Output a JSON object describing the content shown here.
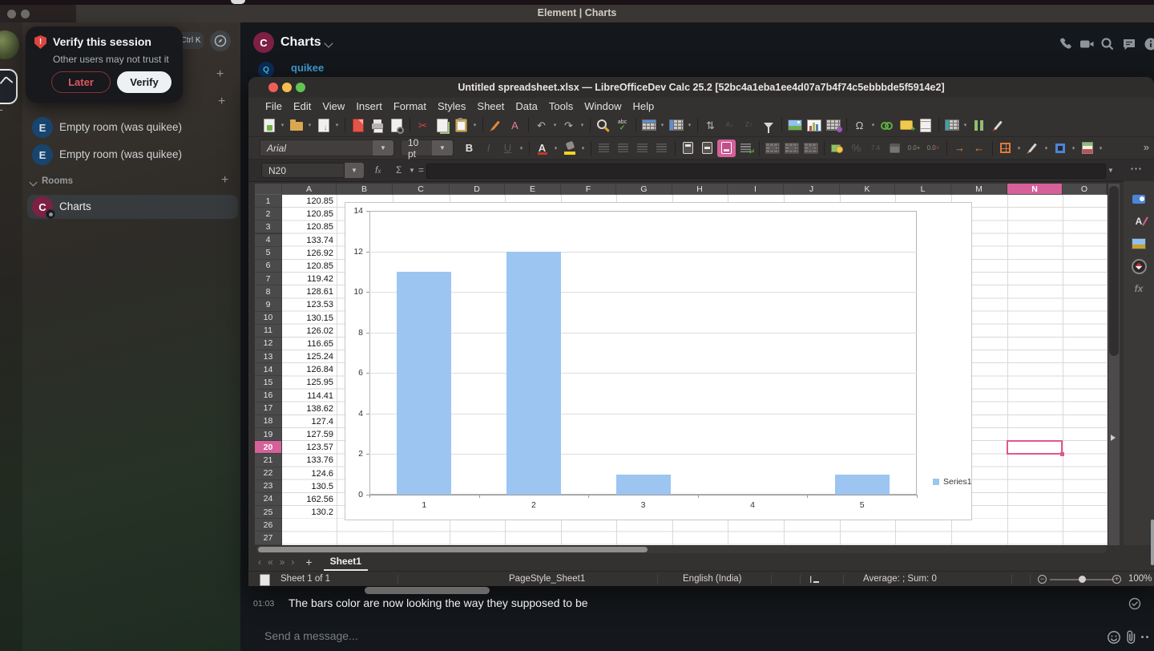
{
  "window": {
    "title": "Element | Charts"
  },
  "sidebar": {
    "shortcut_badge": "Ctrl K",
    "verify_popup": {
      "title": "Verify this session",
      "subtitle": "Other users may not trust it",
      "later_label": "Later",
      "verify_label": "Verify"
    },
    "rooms_label": "Rooms",
    "rooms": [
      {
        "initial": "E",
        "name": "Empty room (was quikee)",
        "color": "#17456e"
      },
      {
        "initial": "E",
        "name": "Empty room (was quikee)",
        "color": "#17456e"
      },
      {
        "initial": "C",
        "name": "Charts",
        "color": "#7d2044",
        "selected": true
      }
    ]
  },
  "room_header": {
    "initial": "C",
    "title": "Charts"
  },
  "sender": {
    "initial": "Q",
    "name": "quikee"
  },
  "message": {
    "time": "01:03",
    "text": "The bars color are now looking the way they supposed to be"
  },
  "composer": {
    "placeholder": "Send a message..."
  },
  "calc": {
    "window_title": "Untitled spreadsheet.xlsx — LibreOfficeDev Calc 25.2 [52bc4a1eba1ee4d07a7b4f74c5ebbbde5f5914e2]",
    "menus": [
      "File",
      "Edit",
      "View",
      "Insert",
      "Format",
      "Styles",
      "Sheet",
      "Data",
      "Tools",
      "Window",
      "Help"
    ],
    "font_name": "Arial",
    "font_size": "10 pt",
    "name_box": "N20",
    "main_toolbar": [
      {
        "name": "new-spreadsheet",
        "dropdown": true
      },
      {
        "name": "open",
        "dropdown": true
      },
      {
        "name": "save",
        "dropdown": true
      },
      {
        "sep": true
      },
      {
        "name": "export-pdf"
      },
      {
        "name": "print"
      },
      {
        "name": "print-preview"
      },
      {
        "sep": true
      },
      {
        "name": "cut",
        "glyph": "✂",
        "color": "#d04b42"
      },
      {
        "name": "copy"
      },
      {
        "name": "paste",
        "dropdown": true
      },
      {
        "sep": true
      },
      {
        "name": "clone-formatting"
      },
      {
        "name": "clear-formatting",
        "glyph": "A",
        "color": "#e57da0"
      },
      {
        "sep": true
      },
      {
        "name": "undo",
        "glyph": "↶",
        "color": "#b9b6b4",
        "dropdown": true
      },
      {
        "name": "redo",
        "glyph": "↷",
        "color": "#b9b6b4",
        "dropdown": true
      },
      {
        "sep": true
      },
      {
        "name": "find-and-replace"
      },
      {
        "name": "spelling"
      },
      {
        "sep": true
      },
      {
        "name": "row",
        "dropdown": true
      },
      {
        "name": "column",
        "dropdown": true
      },
      {
        "sep": true
      },
      {
        "name": "sort",
        "glyph": "⇅",
        "color": "#b9b6b4"
      },
      {
        "name": "sort-ascending",
        "glyph": "A↓",
        "color": "#8a8786",
        "disabled": true,
        "small": true
      },
      {
        "name": "sort-descending",
        "glyph": "Z↑",
        "color": "#8a8786",
        "disabled": true,
        "small": true
      },
      {
        "name": "autofilter"
      },
      {
        "sep": true
      },
      {
        "name": "insert-image"
      },
      {
        "name": "insert-chart"
      },
      {
        "name": "pivot-table"
      },
      {
        "sep": true
      },
      {
        "name": "insert-special-character",
        "glyph": "Ω",
        "color": "#c9c6c4",
        "dropdown": true
      },
      {
        "name": "insert-hyperlink"
      },
      {
        "name": "insert-comment"
      },
      {
        "name": "headers-and-footers"
      },
      {
        "sep": true
      },
      {
        "name": "freeze-rows-and-columns",
        "dropdown": true
      },
      {
        "name": "split-window"
      },
      {
        "name": "show-draw-functions"
      }
    ],
    "format_toolbar": [
      {
        "name": "bold",
        "glyph": "B",
        "color": "#e2dfdd",
        "bold": true
      },
      {
        "name": "italic",
        "glyph": "I",
        "color": "#8a8786",
        "italic": true,
        "disabled": true
      },
      {
        "name": "underline",
        "glyph": "U",
        "color": "#8a8786",
        "underline": true,
        "disabled": true,
        "dropdown": true
      },
      {
        "sep": true
      },
      {
        "name": "font-color",
        "dropdown": true
      },
      {
        "name": "highlighting-color",
        "dropdown": true
      },
      {
        "sep": true
      },
      {
        "name": "align-left",
        "disabled": true
      },
      {
        "name": "align-center",
        "disabled": true
      },
      {
        "name": "align-right",
        "disabled": true
      },
      {
        "name": "justified",
        "disabled": true
      },
      {
        "sep": true
      },
      {
        "name": "align-top"
      },
      {
        "name": "center-vertically"
      },
      {
        "name": "align-bottom",
        "active": true
      },
      {
        "name": "wrap-text"
      },
      {
        "sep": true
      },
      {
        "name": "merge-and-center",
        "disabled": true
      },
      {
        "name": "merge-cells",
        "disabled": true
      },
      {
        "name": "unmerge-cells",
        "disabled": true
      },
      {
        "sep": true
      },
      {
        "name": "format-as-currency"
      },
      {
        "name": "format-as-percent",
        "glyph": "%",
        "color": "#8a8786",
        "disabled": true
      },
      {
        "name": "format-as-number",
        "glyph": "7.4",
        "color": "#8a8786",
        "disabled": true,
        "small": true
      },
      {
        "name": "format-as-date",
        "disabled": true
      },
      {
        "name": "add-decimal-place",
        "glyph": "0.0",
        "color": "#8a8786",
        "small": true
      },
      {
        "name": "delete-decimal-place",
        "glyph": "0.0",
        "color": "#8a8786",
        "small": true
      },
      {
        "sep": true
      },
      {
        "name": "increase-indent",
        "glyph": "→",
        "color": "#e08a3c"
      },
      {
        "name": "decrease-indent",
        "glyph": "←",
        "color": "#e08a3c"
      },
      {
        "sep": true
      },
      {
        "name": "borders",
        "dropdown": true
      },
      {
        "name": "border-style",
        "dropdown": true
      },
      {
        "name": "border-color",
        "dropdown": true
      },
      {
        "name": "conditional-formatting",
        "dropdown": true
      }
    ],
    "columns": [
      "A",
      "B",
      "C",
      "D",
      "E",
      "F",
      "G",
      "H",
      "I",
      "J",
      "K",
      "L",
      "M",
      "N",
      "O"
    ],
    "selected_column": "N",
    "row_count": 27,
    "selected_row": 20,
    "selected_cell": "N20",
    "cells_a": [
      "120.85",
      "120.85",
      "120.85",
      "133.74",
      "126.92",
      "120.85",
      "119.42",
      "128.61",
      "123.53",
      "130.15",
      "126.02",
      "116.65",
      "125.24",
      "126.84",
      "125.95",
      "114.41",
      "138.62",
      "127.4",
      "127.59",
      "123.57",
      "133.76",
      "124.6",
      "130.5",
      "162.56",
      "130.2"
    ],
    "sheet_tab": "Sheet1",
    "status": {
      "sheet_info": "Sheet 1 of 1",
      "page_style": "PageStyle_Sheet1",
      "language": "English (India)",
      "average_sum": "Average: ; Sum: 0",
      "zoom_level": "100%"
    },
    "sidebar_icons": [
      "properties",
      "styles",
      "gallery",
      "navigator",
      "functions"
    ]
  },
  "chart_data": {
    "type": "bar",
    "categories": [
      "1",
      "2",
      "3",
      "4",
      "5"
    ],
    "values": [
      11,
      12,
      1,
      0,
      1
    ],
    "series": [
      {
        "name": "Series1",
        "values": [
          11,
          12,
          1,
          0,
          1
        ]
      }
    ],
    "title": "",
    "xlabel": "",
    "ylabel": "",
    "ylim": [
      0,
      14
    ],
    "yticks": [
      0,
      2,
      4,
      6,
      8,
      10,
      12,
      14
    ],
    "bar_color": "#9cc5f1",
    "grid": true,
    "legend": "Series1",
    "legend_position": "right"
  },
  "colors": {
    "accent_pink": "#d5609a",
    "selection_border": "#e2578f",
    "chrome_dark": "#343131",
    "chat_bg": "#14171b",
    "username_blue": "#3f9cd6"
  }
}
